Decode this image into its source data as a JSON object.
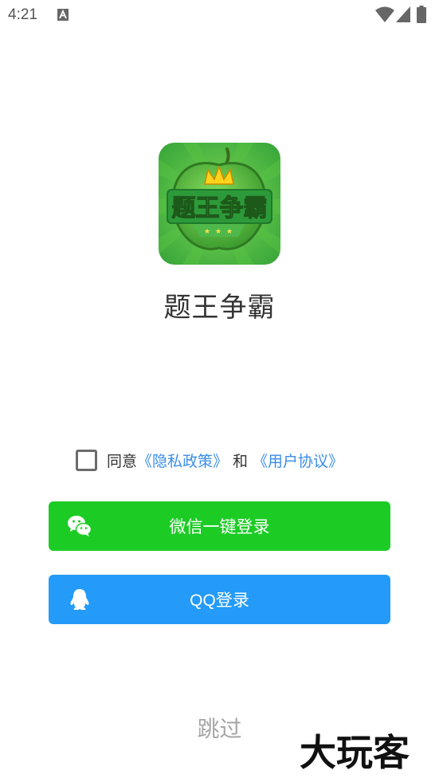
{
  "status_bar": {
    "time": "4:21"
  },
  "app": {
    "logo_text": "题王争霸",
    "name": "题王争霸"
  },
  "agreement": {
    "agree_label": "同意",
    "privacy_link": "《隐私政策》",
    "and_label": "和",
    "terms_link": "《用户协议》"
  },
  "buttons": {
    "wechat_label": "微信一键登录",
    "qq_label": "QQ登录",
    "skip_label": "跳过"
  },
  "watermark": {
    "text": "大玩客"
  },
  "colors": {
    "wechat_green": "#1ccc25",
    "qq_blue": "#249bf8",
    "link_blue": "#3a8ee6"
  }
}
